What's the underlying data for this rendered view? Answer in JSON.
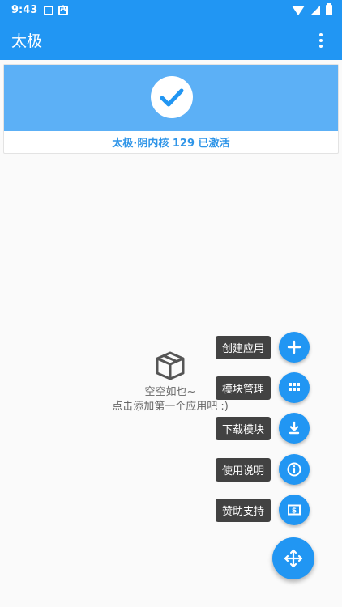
{
  "status_bar": {
    "time": "9:43"
  },
  "app_bar": {
    "title": "太极"
  },
  "status_card": {
    "text": "太极·阴内核 129 已激活"
  },
  "empty_state": {
    "title": "空空如也~",
    "hint": "点击添加第一个应用吧 :)"
  },
  "speed_dial": {
    "items": [
      {
        "label": "创建应用",
        "icon": "plus-icon"
      },
      {
        "label": "模块管理",
        "icon": "grid-icon"
      },
      {
        "label": "下载模块",
        "icon": "download-icon"
      },
      {
        "label": "使用说明",
        "icon": "info-icon"
      },
      {
        "label": "赞助支持",
        "icon": "dollar-icon"
      }
    ]
  },
  "colors": {
    "primary": "#2196f3",
    "banner": "#5cb0f6",
    "status_text": "#2f95e8",
    "label_bg": "#424242"
  }
}
